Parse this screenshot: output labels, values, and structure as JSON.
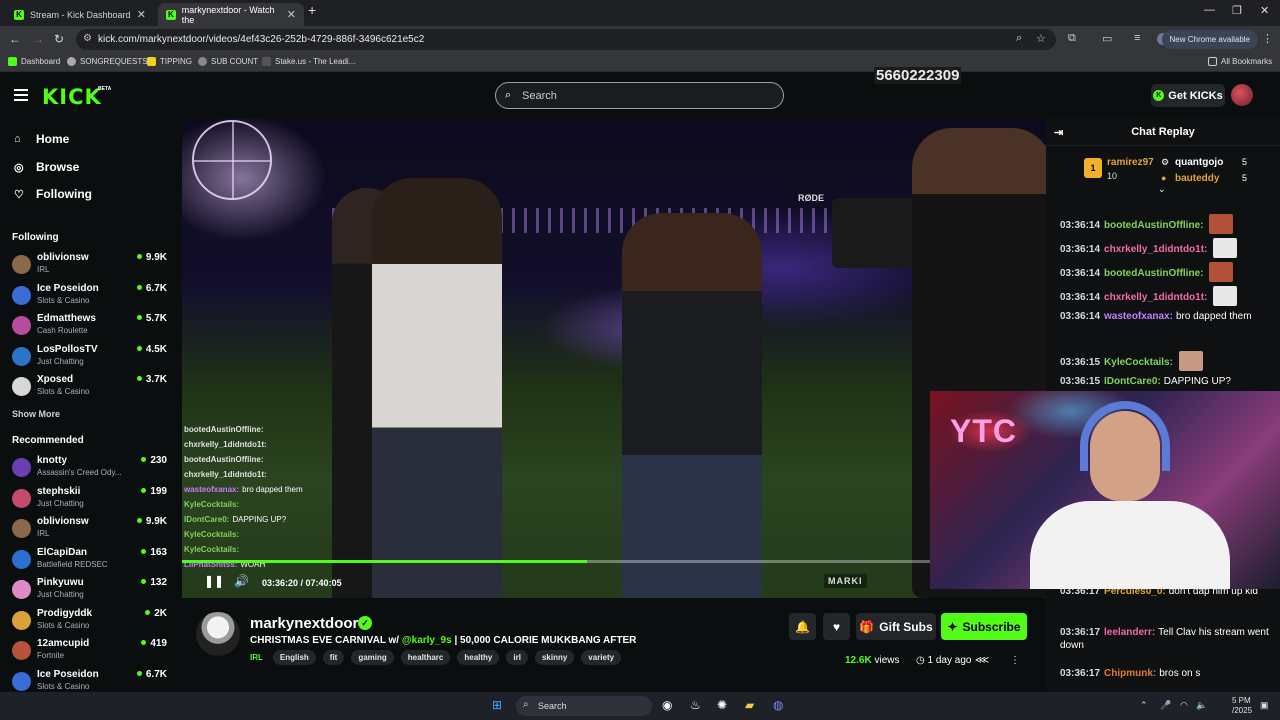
{
  "browser": {
    "tabs": [
      {
        "title": "Stream - Kick Dashboard"
      },
      {
        "title": "markynextdoor - Watch the"
      }
    ],
    "url": "kick.com/markynextdoor/videos/4ef43c26-252b-4729-886f-3496c621e5c2",
    "new_chrome": "New Chrome available",
    "bookmarks": [
      "Dashboard",
      "SONGREQUESTS",
      "TIPPING",
      "SUB COUNT",
      "Stake.us - The Leadi..."
    ],
    "all_bookmarks": "All Bookmarks"
  },
  "header": {
    "logo": "KICK",
    "beta": "BETA",
    "search_placeholder": "Search",
    "overlay_number": "5660222309",
    "get_kicks": "Get KICKs"
  },
  "sidebar": {
    "nav": [
      {
        "label": "Home",
        "icon": "home-icon"
      },
      {
        "label": "Browse",
        "icon": "compass-icon"
      },
      {
        "label": "Following",
        "icon": "heart-icon"
      }
    ],
    "following_title": "Following",
    "following": [
      {
        "name": "oblivionsw",
        "category": "IRL",
        "viewers": "9.9K",
        "color": "#8a6a4a"
      },
      {
        "name": "Ice Poseidon",
        "category": "Slots & Casino",
        "viewers": "6.7K",
        "color": "#3b6bd6"
      },
      {
        "name": "Edmatthews",
        "category": "Cash Roulette",
        "viewers": "5.7K",
        "color": "#b84aa0"
      },
      {
        "name": "LosPollosTV",
        "category": "Just Chatting",
        "viewers": "4.5K",
        "color": "#2a74c9"
      },
      {
        "name": "Xposed",
        "category": "Slots & Casino",
        "viewers": "3.7K",
        "color": "#d8d8d8"
      }
    ],
    "show_more": "Show More",
    "recommended_title": "Recommended",
    "recommended": [
      {
        "name": "knotty",
        "category": "Assassin's Creed Ody...",
        "viewers": "230",
        "color": "#6b3fb0"
      },
      {
        "name": "stephskii",
        "category": "Just Chatting",
        "viewers": "199",
        "color": "#c24a6a"
      },
      {
        "name": "oblivionsw",
        "category": "IRL",
        "viewers": "9.9K",
        "color": "#8a6a4a"
      },
      {
        "name": "ElCapiDan",
        "category": "Battlefield REDSEC",
        "viewers": "163",
        "color": "#2d6fd1"
      },
      {
        "name": "Pinkyuwu",
        "category": "Just Chatting",
        "viewers": "132",
        "color": "#e08ac5"
      },
      {
        "name": "Prodigyddk",
        "category": "Slots & Casino",
        "viewers": "2K",
        "color": "#d9a13b"
      },
      {
        "name": "12amcupid",
        "category": "Fortnite",
        "viewers": "419",
        "color": "#b5523b"
      },
      {
        "name": "Ice Poseidon",
        "category": "Slots & Casino",
        "viewers": "6.7K",
        "color": "#3b6bd6"
      }
    ]
  },
  "video": {
    "current_time": "03:36:20",
    "duration": "07:40:05",
    "progress": 0.54,
    "rode_label": "RØDE",
    "watermark": "MARKI",
    "overlay_chat": [
      {
        "user": "bootedAustinOffline:",
        "text": "",
        "color": "#e0e0e0"
      },
      {
        "user": "chxrkelly_1didntdo1t:",
        "text": "",
        "color": "#e0e0e0"
      },
      {
        "user": "bootedAustinOffline:",
        "text": "",
        "color": "#e0e0e0"
      },
      {
        "user": "chxrkelly_1didntdo1t:",
        "text": "",
        "color": "#e0e0e0"
      },
      {
        "user": "wasteofxanax:",
        "text": "bro dapped them",
        "color": "#c77dff"
      },
      {
        "user": "KyleCocktails:",
        "text": "",
        "color": "#7fd45a"
      },
      {
        "user": "IDontCare0:",
        "text": "DAPPING UP?",
        "color": "#7fd45a"
      },
      {
        "user": "KyleCocktails:",
        "text": "",
        "color": "#7fd45a"
      },
      {
        "user": "KyleCocktails:",
        "text": "",
        "color": "#7fd45a"
      },
      {
        "user": "LilPhatShitss:",
        "text": "WOAH",
        "color": "#c77dff"
      }
    ]
  },
  "channel": {
    "name": "markynextdoor",
    "title_prefix": "CHRISTMAS EVE CARNIVAL w/ ",
    "title_mention": "@karly_9s",
    "title_suffix": " | 50,000 CALORIE MUKKBANG AFTER",
    "category": "IRL",
    "tags": [
      "English",
      "fit",
      "gaming",
      "healtharc",
      "healthy",
      "irl",
      "skinny",
      "variety"
    ],
    "gift_subs": "Gift Subs",
    "subscribe": "Subscribe",
    "views": "12.6K",
    "views_label": "views",
    "age": "1 day ago"
  },
  "chat": {
    "title": "Chat Replay",
    "leaderboard": [
      {
        "name": "ramirez97",
        "count": "10"
      },
      {
        "name": "quantgojo",
        "count": "5"
      },
      {
        "name": "bauteddy",
        "count": "5"
      }
    ],
    "rank": "1",
    "messages": [
      {
        "time": "03:36:14",
        "user": "bootedAustinOffline:",
        "text": "",
        "color": "#7fd45a",
        "emote": "#b3503a"
      },
      {
        "time": "03:36:14",
        "user": "chxrkelly_1didntdo1t:",
        "text": "",
        "color": "#f06aa8",
        "emote": "#e8e8e8"
      },
      {
        "time": "03:36:14",
        "user": "bootedAustinOffline:",
        "text": "",
        "color": "#7fd45a",
        "emote": "#b3503a"
      },
      {
        "time": "03:36:14",
        "user": "chxrkelly_1didntdo1t:",
        "text": "",
        "color": "#f06aa8",
        "emote": "#e8e8e8"
      },
      {
        "time": "03:36:14",
        "user": "wasteofxanax:",
        "text": "bro dapped them",
        "color": "#c77dff",
        "emote": ""
      },
      {
        "time": "03:36:15",
        "user": "KyleCocktails:",
        "text": "",
        "color": "#7fd45a",
        "emote": "#c49a80"
      },
      {
        "time": "03:36:15",
        "user": "IDontCare0:",
        "text": "DAPPING UP?",
        "color": "#7fd45a",
        "emote": ""
      },
      {
        "time": "03:36:17",
        "user": "Percules0_0:",
        "text": "don't dap him up kid",
        "color": "#e2a53a",
        "emote": ""
      },
      {
        "time": "03:36:17",
        "user": "leelanderr:",
        "text": "Tell Clav his stream went down",
        "color": "#f06aa8",
        "emote": ""
      },
      {
        "time": "03:36:17",
        "user": "Chipmunk:",
        "text": "bros on s",
        "color": "#e27a3a",
        "emote": ""
      }
    ],
    "cam_text": "YTC"
  },
  "taskbar": {
    "search": "Search",
    "time": "5 PM",
    "date": "/2025"
  }
}
